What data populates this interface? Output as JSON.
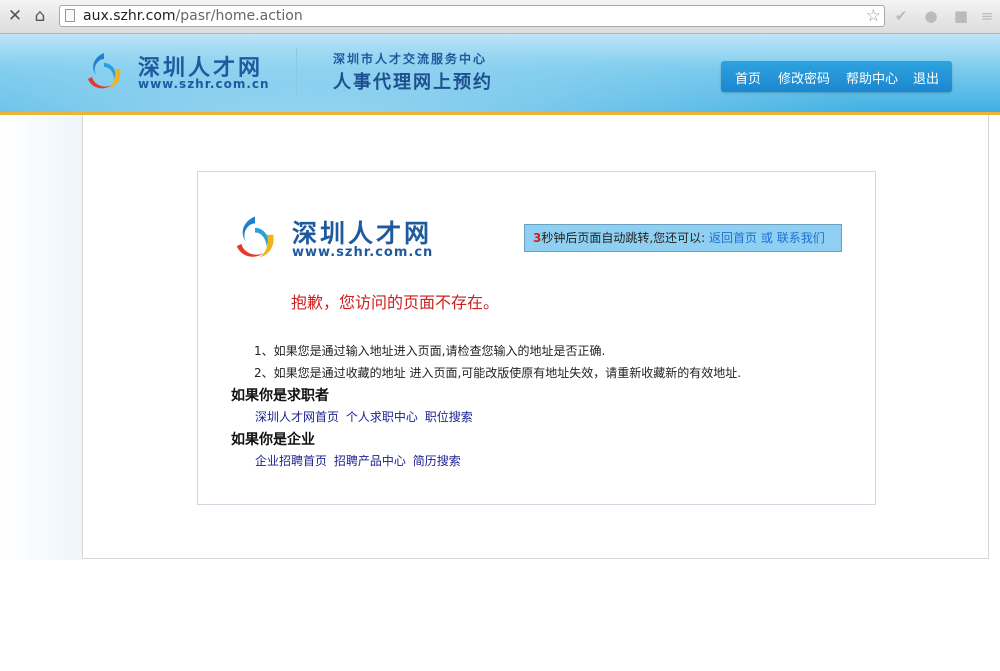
{
  "browser": {
    "url_host": "aux.szhr.com",
    "url_path": "/pasr/home.action"
  },
  "header": {
    "logo_cn": "深圳人才网",
    "logo_url": "www.szhr.com.cn",
    "center_name": "深圳市人才交流服务中心",
    "service_title": "人事代理网上预约",
    "nav": [
      "首页",
      "修改密码",
      "帮助中心",
      "退出"
    ]
  },
  "content": {
    "logo_cn": "深圳人才网",
    "logo_url": "www.szhr.com.cn",
    "countdown": "3",
    "redirect_text": "秒钟后页面自动跳转,您还可以:",
    "back_home": "返回首页",
    "or_text": "或",
    "contact_us": "联系我们",
    "error_title": "抱歉，您访问的页面不存在。",
    "tips": [
      "1、如果您是通过输入地址进入页面,请检查您输入的地址是否正确.",
      "2、如果您是通过收藏的地址 进入页面,可能改版使原有地址失效，请重新收藏新的有效地址."
    ],
    "jobseeker_heading": "如果你是求职者",
    "jobseeker_links": [
      "深圳人才网首页",
      "个人求职中心",
      "职位搜索"
    ],
    "company_heading": "如果你是企业",
    "company_links": [
      "企业招聘首页",
      "招聘产品中心",
      "简历搜索"
    ]
  },
  "colors": {
    "header_blue": "#3fb0e3",
    "nav_blue": "#1c86cf",
    "brand_text": "#1f5a9e",
    "error_red": "#cc1f1f",
    "link_navy": "#1b1f8f",
    "accent_gold": "#e8b43a"
  },
  "icons": [
    "close-icon",
    "home-icon",
    "star-icon",
    "checkmark-icon",
    "extension-icon",
    "page-icon",
    "szhr-logo-icon"
  ]
}
